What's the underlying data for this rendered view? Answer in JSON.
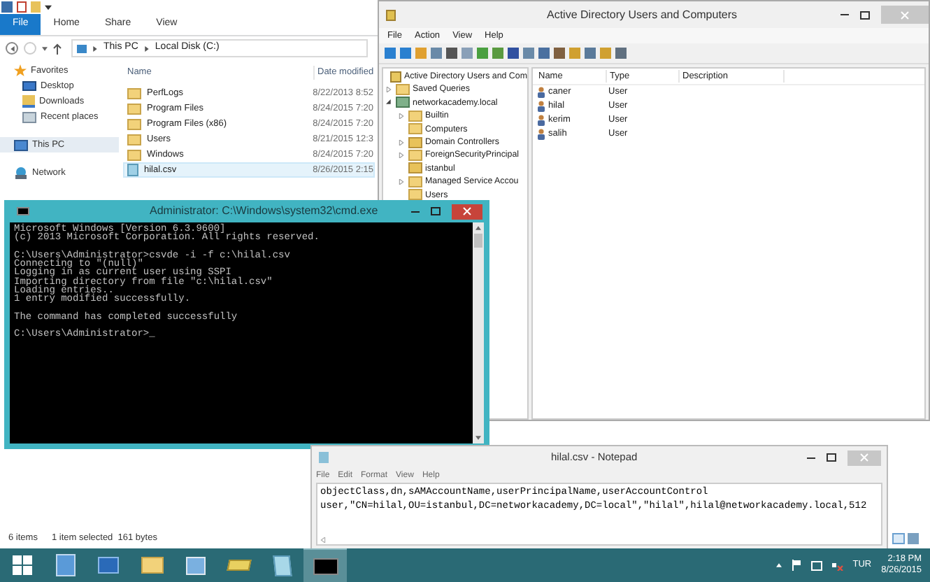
{
  "explorer": {
    "ribbon_tabs": [
      {
        "label": "File",
        "selected": true
      },
      {
        "label": "Home",
        "selected": false
      },
      {
        "label": "Share",
        "selected": false
      },
      {
        "label": "View",
        "selected": false
      }
    ],
    "breadcrumb": [
      "This PC",
      "Local Disk (C:)"
    ],
    "nav": [
      {
        "label": "Favorites",
        "kind": "star",
        "selected": false,
        "children": [
          {
            "label": "Desktop",
            "kind": "desktop",
            "selected": false
          },
          {
            "label": "Downloads",
            "kind": "download",
            "selected": false
          },
          {
            "label": "Recent places",
            "kind": "recent",
            "selected": false
          }
        ]
      },
      {
        "label": "This PC",
        "kind": "pc",
        "selected": true
      },
      {
        "label": "Network",
        "kind": "network",
        "selected": false
      }
    ],
    "columns": [
      "Name",
      "Date modified"
    ],
    "files": [
      {
        "name": "PerfLogs",
        "date": "8/22/2013 8:52",
        "kind": "folder",
        "selected": false
      },
      {
        "name": "Program Files",
        "date": "8/24/2015 7:20",
        "kind": "folder",
        "selected": false
      },
      {
        "name": "Program Files (x86)",
        "date": "8/24/2015 7:20",
        "kind": "folder",
        "selected": false
      },
      {
        "name": "Users",
        "date": "8/21/2015 12:3",
        "kind": "folder",
        "selected": false
      },
      {
        "name": "Windows",
        "date": "8/24/2015 7:20",
        "kind": "folder",
        "selected": false
      },
      {
        "name": "hilal.csv",
        "date": "8/26/2015 2:15",
        "kind": "file",
        "selected": true
      }
    ],
    "status": [
      "6 items",
      "1 item selected  161 bytes"
    ]
  },
  "aduc": {
    "title": "Active Directory Users and Computers",
    "menu": [
      "File",
      "Action",
      "View",
      "Help"
    ],
    "tree": [
      {
        "label": "Active Directory Users and Com",
        "kind": "root",
        "children": [
          {
            "label": "Saved Queries",
            "kind": "folder",
            "expanded": false
          },
          {
            "label": "networkacademy.local",
            "kind": "domain",
            "expanded": true,
            "children": [
              {
                "label": "Builtin",
                "kind": "folder",
                "expanded": false
              },
              {
                "label": "Computers",
                "kind": "folder"
              },
              {
                "label": "Domain Controllers",
                "kind": "ou",
                "expanded": false
              },
              {
                "label": "ForeignSecurityPrincipal",
                "kind": "folder",
                "expanded": false
              },
              {
                "label": "istanbul",
                "kind": "ou"
              },
              {
                "label": "Managed Service Accou",
                "kind": "folder",
                "expanded": false
              },
              {
                "label": "Users",
                "kind": "folder"
              }
            ]
          }
        ]
      }
    ],
    "columns": [
      "Name",
      "Type",
      "Description"
    ],
    "users": [
      {
        "name": "caner",
        "type": "User"
      },
      {
        "name": "hilal",
        "type": "User"
      },
      {
        "name": "kerim",
        "type": "User"
      },
      {
        "name": "salih",
        "type": "User"
      }
    ]
  },
  "cmd": {
    "title": "Administrator: C:\\Windows\\system32\\cmd.exe",
    "blocks": [
      [
        "Microsoft Windows [Version 6.3.9600]",
        "(c) 2013 Microsoft Corporation. All rights reserved."
      ],
      [
        "C:\\Users\\Administrator>csvde -i -f c:\\hilal.csv",
        "Connecting to \"(null)\"",
        "Logging in as current user using SSPI",
        "Importing directory from file \"c:\\hilal.csv\"",
        "Loading entries..",
        "1 entry modified successfully."
      ],
      [
        "The command has completed successfully"
      ],
      [
        "C:\\Users\\Administrator>_"
      ]
    ]
  },
  "notepad": {
    "title": "hilal.csv - Notepad",
    "menu": [
      "File",
      "Edit",
      "Format",
      "View",
      "Help"
    ],
    "lines": [
      "objectClass,dn,sAMAccountName,userPrincipalName,userAccountControl",
      "user,\"CN=hilal,OU=istanbul,DC=networkacademy,DC=local\",\"hilal\",hilal@networkacademy.local,512"
    ]
  },
  "taskbar": {
    "apps": [
      {
        "kind": "start",
        "active": false
      },
      {
        "kind": "server",
        "active": false
      },
      {
        "kind": "powershell",
        "active": false
      },
      {
        "kind": "explorer",
        "active": false
      },
      {
        "kind": "control",
        "active": false
      },
      {
        "kind": "book",
        "active": false
      },
      {
        "kind": "notepad",
        "active": false
      },
      {
        "kind": "cmd",
        "active": true
      }
    ],
    "language": "TUR",
    "time": "2:18 PM",
    "date": "8/26/2015"
  }
}
